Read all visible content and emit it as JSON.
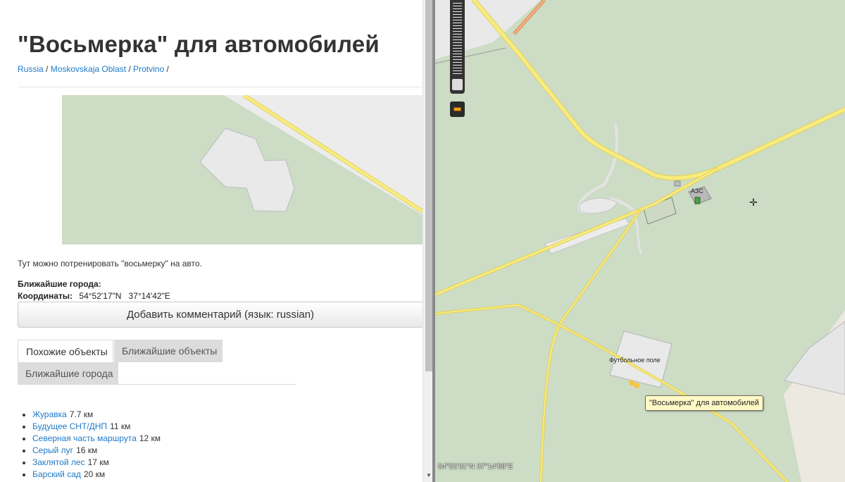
{
  "page": {
    "title": "\"Восьмерка\" для автомобилей",
    "breadcrumb": [
      {
        "label": "Russia"
      },
      {
        "label": "Moskovskaja Oblast"
      },
      {
        "label": "Protvino"
      }
    ],
    "breadcrumb_separator": " / ",
    "description": "Тут можно потренировать \"восьмерку\" на авто.",
    "nearest_cities_label": "Ближайшие города:",
    "coordinates_label": "Координаты:",
    "coordinates_value": "54°52'17\"N   37°14'42\"E",
    "add_comment_button": "Добавить комментарий (язык: russian)",
    "tabs": [
      {
        "label": "Похожие объекты",
        "active": true
      },
      {
        "label": "Ближайшие объекты",
        "active": false
      },
      {
        "label": "Ближайшие города",
        "active": false
      }
    ],
    "cities": [
      {
        "name": "Журавка",
        "distance": "7.7 км"
      },
      {
        "name": "Будущее СНТ/ДНП",
        "distance": "11 км"
      },
      {
        "name": "Северная часть маршрута",
        "distance": "12 км"
      },
      {
        "name": "Серый луг",
        "distance": "16 км"
      },
      {
        "name": "Заклятой лес",
        "distance": "17 км"
      },
      {
        "name": "Барский сад",
        "distance": "20 км"
      }
    ]
  },
  "map": {
    "label_azs": "АЗС",
    "label_football": "Футбольное поле",
    "tooltip": "\"Восьмерка\" для автомобилей",
    "coordinates": "54°52'31\"N 37°14'58\"E",
    "icons": {
      "zoom": "zoom-slider",
      "ruler": "ruler-icon",
      "cursor": "crosshair-cursor-icon",
      "fuel": "fuel-pump-icon"
    }
  },
  "colors": {
    "forest": "#cddcc5",
    "road": "#f7ec80",
    "area": "#ececec",
    "link": "#1e7ac9",
    "tooltip_bg": "#fff9c6"
  }
}
